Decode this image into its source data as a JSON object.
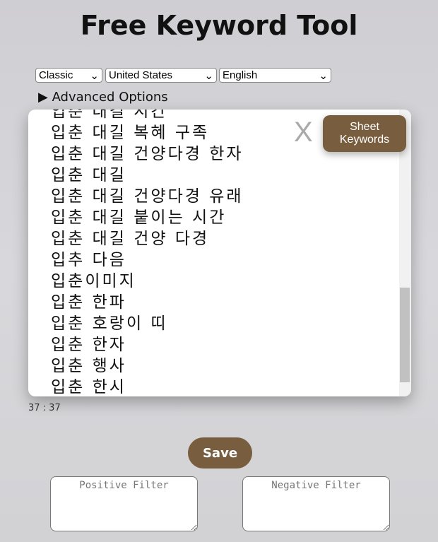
{
  "title": "Free Keyword Tool",
  "selects": {
    "mode": "Classic",
    "country": "United States",
    "language": "English"
  },
  "advanced": "▶ Advanced Options",
  "keywords": [
    "입춘 대길 시간",
    "입춘 대길 복혜 구족",
    "입춘 대길 건양다경 한자",
    "입춘 대길",
    "입춘 대길 건양다경 유래",
    "입춘 대길 붙이는 시간",
    "입춘 대길 건양 다경",
    "입추 다음",
    "입춘이미지",
    "입춘 한파",
    "입춘 호랑이 띠",
    "입춘 한자",
    "입춘 행사",
    "입춘 한시"
  ],
  "clear_label": "X",
  "sheet_label": [
    "Sheet",
    "Keywords"
  ],
  "count": "37 : 37",
  "save_label": "Save",
  "positive_placeholder": "Positive Filter",
  "negative_placeholder": "Negative Filter",
  "colors": {
    "accent": "#785d3f"
  }
}
